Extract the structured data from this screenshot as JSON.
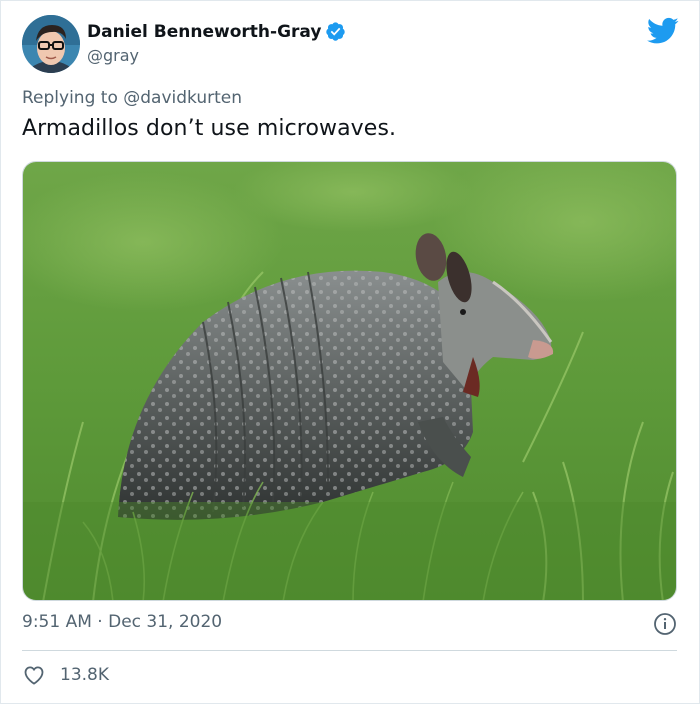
{
  "author": {
    "display_name": "Daniel Benneworth-Gray",
    "handle": "@gray",
    "verified": true
  },
  "reply": {
    "prefix": "Replying to",
    "target": "@davidkurten"
  },
  "tweet": {
    "text": "Armadillos don’t use microwaves.",
    "time": "9:51 AM",
    "separator": "·",
    "date": "Dec 31, 2020"
  },
  "stats": {
    "likes": "13.8K"
  },
  "icons": {
    "brand": "twitter-bird-icon",
    "verified": "verified-badge-icon",
    "info": "info-icon",
    "like": "heart-icon"
  },
  "colors": {
    "brand": "#1d9bf0",
    "text": "#0f1419",
    "secondary": "#536471",
    "divider": "#cfd9de"
  }
}
